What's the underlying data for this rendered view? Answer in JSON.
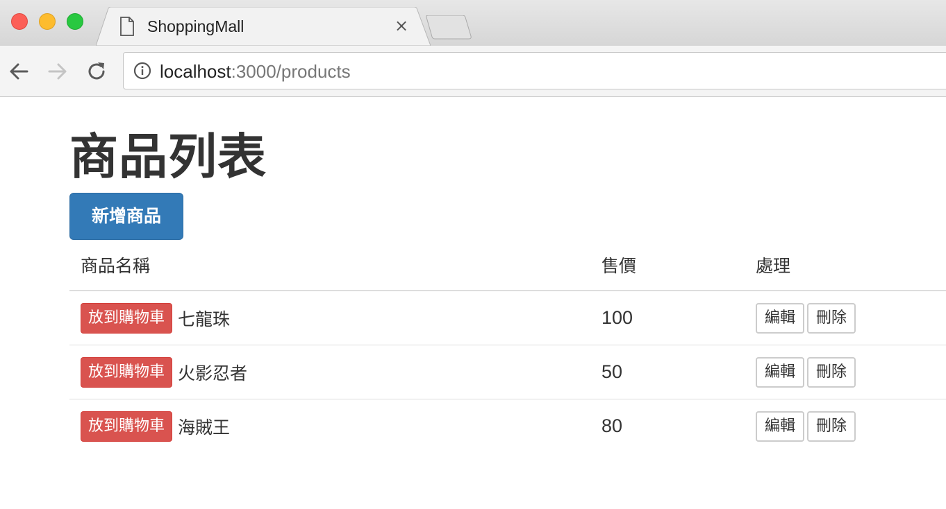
{
  "browser": {
    "tab_title": "ShoppingMall",
    "tab_close_glyph": "×",
    "url_host": "localhost",
    "url_rest": ":3000/products",
    "icons": [
      "document-icon",
      "close-icon",
      "back-icon",
      "forward-icon",
      "reload-icon",
      "info-icon"
    ]
  },
  "page": {
    "title": "商品列表",
    "new_button_label": "新增商品",
    "table": {
      "headers": [
        "商品名稱",
        "售價",
        "處理"
      ],
      "rows": [
        {
          "cart_label": "放到購物車",
          "name": "七龍珠",
          "price": "100",
          "edit_label": "編輯",
          "delete_label": "刪除"
        },
        {
          "cart_label": "放到購物車",
          "name": "火影忍者",
          "price": "50",
          "edit_label": "編輯",
          "delete_label": "刪除"
        },
        {
          "cart_label": "放到購物車",
          "name": "海賊王",
          "price": "80",
          "edit_label": "編輯",
          "delete_label": "刪除"
        }
      ]
    }
  },
  "colors": {
    "primary": "#337ab7",
    "danger": "#d9534f",
    "text": "#333333",
    "border": "#dddddd"
  }
}
